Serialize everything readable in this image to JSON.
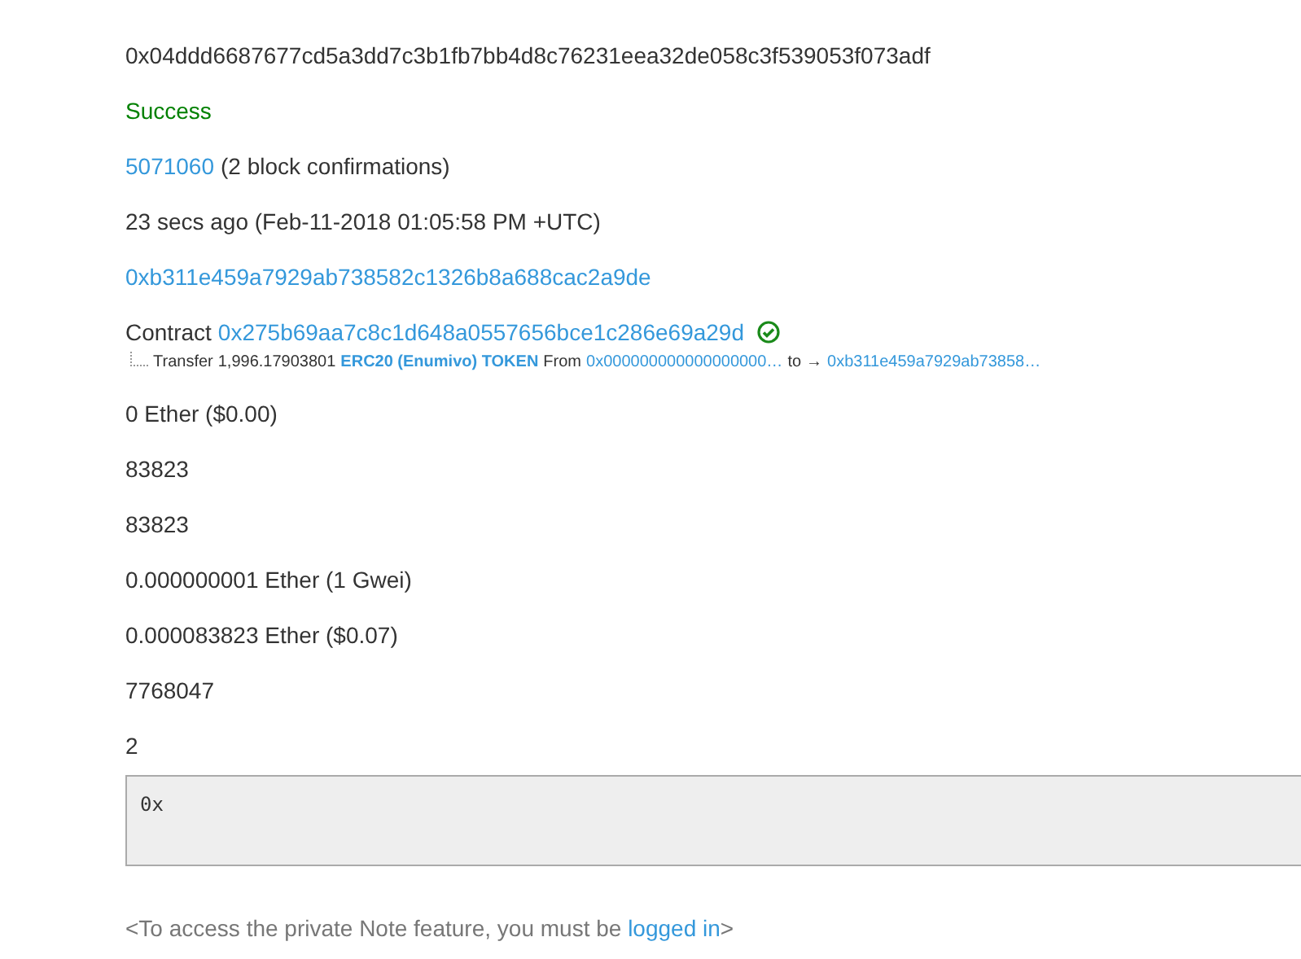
{
  "details": [
    {
      "kind": "text",
      "text": "0x04ddd6687677cd5a3dd7c3b1fb7bb4d8c76231eea32de058c3f539053f073adf"
    },
    {
      "kind": "status",
      "text": "Success",
      "color": "#008000"
    },
    {
      "kind": "block",
      "link": "5071060",
      "text": "(2 block confirmations)"
    },
    {
      "kind": "text",
      "text": "23 secs ago (Feb-11-2018 01:05:58 PM +UTC)"
    },
    {
      "kind": "link",
      "link": "0xb311e459a7929ab738582c1326b8a688cac2a9de"
    },
    {
      "kind": "contract",
      "text": "Contract",
      "link": "0x275b69aa7c8c1d648a0557656bce1c286e69a29d",
      "verified": true,
      "transfer": {
        "label": "Transfer",
        "amount": "1,996.17903801",
        "token": "ERC20 (Enumivo) TOKEN",
        "from_label": "From",
        "from": "0x000000000000000000…",
        "to_label": "to",
        "arrow": "→",
        "to": "0xb311e459a7929ab73858…"
      }
    },
    {
      "kind": "text",
      "text": "0 Ether ($0.00)"
    },
    {
      "kind": "text",
      "text": "83823"
    },
    {
      "kind": "text",
      "text": "83823"
    },
    {
      "kind": "text",
      "text": "0.000000001 Ether (1 Gwei)"
    },
    {
      "kind": "text",
      "text": "0.000083823 Ether ($0.07)"
    },
    {
      "kind": "text",
      "text": "7768047"
    },
    {
      "kind": "text",
      "text": "2"
    },
    {
      "kind": "input",
      "value": "0x"
    }
  ],
  "note": {
    "before": "<To access the private Note feature, you must be ",
    "link": "logged in",
    "after": ">"
  }
}
